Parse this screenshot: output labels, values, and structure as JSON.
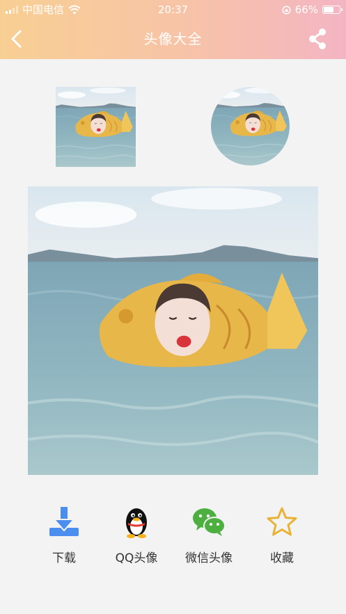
{
  "status": {
    "carrier": "中国电信",
    "time": "20:37",
    "battery_percent": "66%",
    "battery_level": 0.66
  },
  "nav": {
    "title": "头像大全"
  },
  "actions": [
    {
      "label": "下载",
      "icon": "download-icon",
      "color": "#4a8ef0"
    },
    {
      "label": "QQ头像",
      "icon": "qq-penguin-icon",
      "color": "#000000"
    },
    {
      "label": "微信头像",
      "icon": "wechat-icon",
      "color": "#4caf3f"
    },
    {
      "label": "收藏",
      "icon": "star-icon",
      "color": "#e8b234"
    }
  ],
  "colors": {
    "header_start": "#f8cf93",
    "header_end": "#f3b5c3",
    "background": "#f3f3f3"
  }
}
